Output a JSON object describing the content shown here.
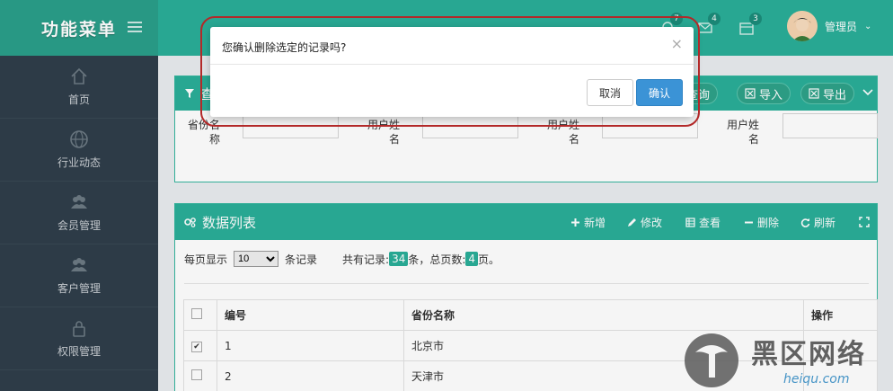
{
  "sidebar": {
    "title": "功能菜单",
    "items": [
      {
        "label": "首页",
        "icon": "home-icon"
      },
      {
        "label": "行业动态",
        "icon": "globe-icon"
      },
      {
        "label": "会员管理",
        "icon": "users-icon"
      },
      {
        "label": "客户管理",
        "icon": "users-icon"
      },
      {
        "label": "权限管理",
        "icon": "lock-icon"
      }
    ]
  },
  "header": {
    "badges": [
      "7",
      "4",
      "3"
    ],
    "user_name": "管理员"
  },
  "query_panel": {
    "title": "查",
    "buttons": [
      "查询",
      "导入",
      "导出"
    ],
    "fields": [
      "省份名称",
      "用户姓名",
      "用户姓名",
      "用户姓名"
    ]
  },
  "list_panel": {
    "title": "数据列表",
    "tools": [
      "新增",
      "修改",
      "查看",
      "删除",
      "刷新"
    ],
    "page_size_label": "每页显示",
    "page_size": "10",
    "records_suffix": "条记录",
    "total_label": "共有记录:",
    "total_records": "34",
    "total_mid": "条，总页数:",
    "total_pages": "4",
    "total_suffix": "页。",
    "columns": [
      "编号",
      "省份名称",
      "操作"
    ],
    "rows": [
      {
        "id": "1",
        "name": "北京市",
        "checked": true
      },
      {
        "id": "2",
        "name": "天津市",
        "checked": false
      }
    ]
  },
  "modal": {
    "message": "您确认删除选定的记录吗?",
    "cancel": "取消",
    "confirm": "确认",
    "close": "×"
  },
  "watermark": {
    "text": "黑区网络",
    "url_text": "heiqu.com"
  },
  "colors": {
    "accent": "#2aae98",
    "sidebar": "#2f3e4a",
    "primary_button": "#3b93d6",
    "highlight": "#b32929"
  }
}
